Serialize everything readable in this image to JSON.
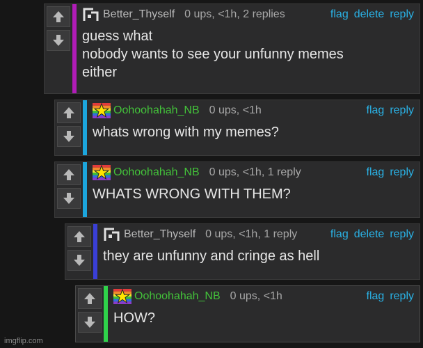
{
  "comments": [
    {
      "username": "Better_Thyself",
      "avatar": "better-thyself-avatar",
      "user_color": "#b9b9b9",
      "meta": "0 ups, <1h, 2 replies",
      "actions": [
        "flag",
        "delete",
        "reply"
      ],
      "lines": [
        "guess what",
        "nobody wants to see your unfunny memes",
        "either"
      ],
      "accent": "#b01cb7"
    },
    {
      "username": "Oohoohahah_NB",
      "avatar": "rainbow-star-avatar",
      "user_color": "#43c23a",
      "meta": "0 ups, <1h",
      "actions": [
        "flag",
        "reply"
      ],
      "lines": [
        "whats wrong with my memes?"
      ],
      "accent": "#1ca6dd"
    },
    {
      "username": "Oohoohahah_NB",
      "avatar": "rainbow-star-avatar",
      "user_color": "#43c23a",
      "meta": "0 ups, <1h, 1 reply",
      "actions": [
        "flag",
        "reply"
      ],
      "lines": [
        "WHATS WRONG WITH THEM?"
      ],
      "accent": "#1ca6dd"
    },
    {
      "username": "Better_Thyself",
      "avatar": "better-thyself-avatar",
      "user_color": "#b9b9b9",
      "meta": "0 ups, <1h, 1 reply",
      "actions": [
        "flag",
        "delete",
        "reply"
      ],
      "lines": [
        "they are unfunny and cringe as hell"
      ],
      "accent": "#3a3fd6"
    },
    {
      "username": "Oohoohahah_NB",
      "avatar": "rainbow-star-avatar",
      "user_color": "#43c23a",
      "meta": "0 ups, <1h",
      "actions": [
        "flag",
        "reply"
      ],
      "lines": [
        "HOW?"
      ],
      "accent": "#2fd24a"
    }
  ],
  "icons": {
    "upvote": "up-arrow-icon",
    "downvote": "down-arrow-icon"
  },
  "colors": {
    "link": "#2ab2e6",
    "background": "#161616",
    "panel": "#2b2b2c"
  },
  "watermark": "imgflip.com"
}
